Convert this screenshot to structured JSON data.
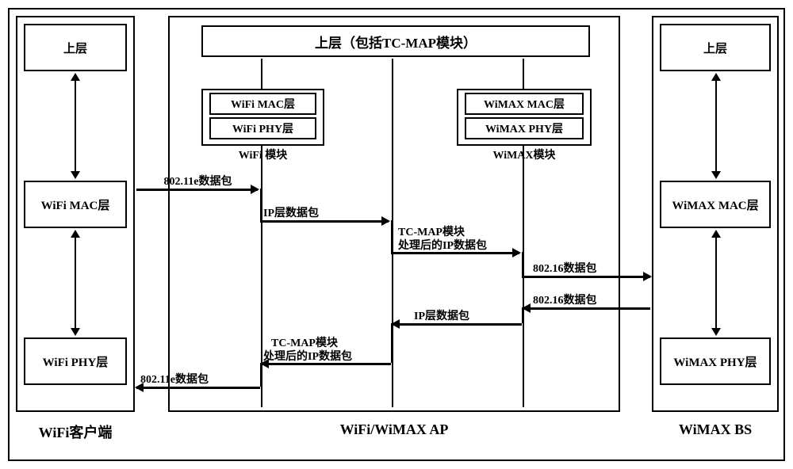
{
  "left": {
    "upper": "上层",
    "mac": "WiFi MAC层",
    "phy": "WiFi PHY层",
    "caption": "WiFi客户端"
  },
  "mid": {
    "upper": "上层（包括TC-MAP模块）",
    "wifi_mac": "WiFi MAC层",
    "wifi_phy": "WiFi PHY层",
    "wifi_cap": "WiFi 模块",
    "wimax_mac": "WiMAX MAC层",
    "wimax_phy": "WiMAX PHY层",
    "wimax_cap": "WiMAX模块",
    "caption": "WiFi/WiMAX AP"
  },
  "right": {
    "upper": "上层",
    "mac": "WiMAX MAC层",
    "phy": "WiMAX PHY层",
    "caption": "WiMAX BS"
  },
  "arrows": {
    "l1": "802.11e数据包",
    "l2": "IP层数据包",
    "l3a": "TC-MAP模块",
    "l3b": "处理后的IP数据包",
    "l4": "802.16数据包",
    "r1": "802.16数据包",
    "r2": "IP层数据包",
    "r3a": "TC-MAP模块",
    "r3b": "处理后的IP数据包",
    "r4": "802.11e数据包"
  }
}
